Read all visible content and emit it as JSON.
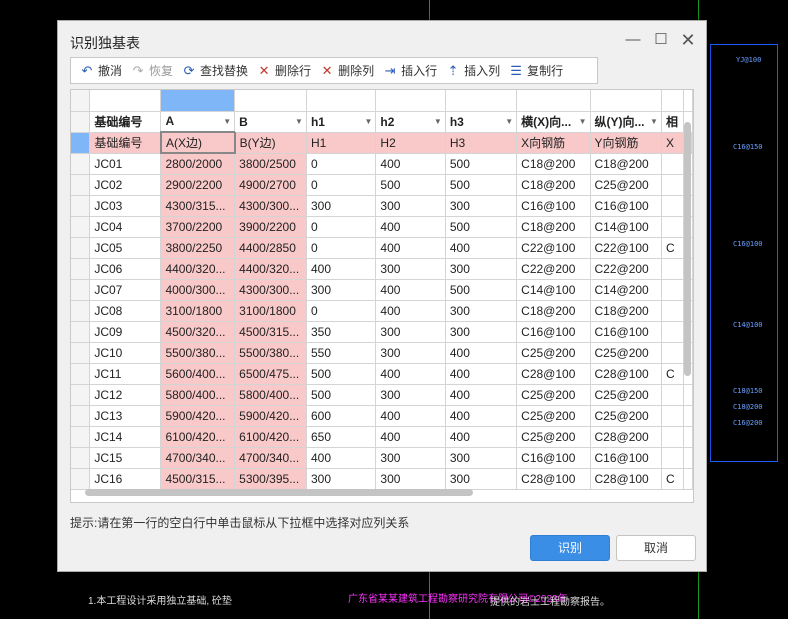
{
  "dialog": {
    "title": "识别独基表",
    "hint": "提示:请在第一行的空白行中单击鼠标从下拉框中选择对应列关系",
    "ok_label": "识别",
    "cancel_label": "取消"
  },
  "toolbar": [
    {
      "label": "撤消",
      "icon": "undo-icon",
      "glyph": "↶",
      "enabled": true
    },
    {
      "label": "恢复",
      "icon": "redo-icon",
      "glyph": "↷",
      "enabled": false
    },
    {
      "label": "查找替换",
      "icon": "find-replace-icon",
      "glyph": "⟳",
      "enabled": true
    },
    {
      "label": "删除行",
      "icon": "delete-row-icon",
      "glyph": "✕",
      "enabled": true
    },
    {
      "label": "删除列",
      "icon": "delete-column-icon",
      "glyph": "✕",
      "enabled": true
    },
    {
      "label": "插入行",
      "icon": "insert-row-icon",
      "glyph": "⇥",
      "enabled": true
    },
    {
      "label": "插入列",
      "icon": "insert-column-icon",
      "glyph": "⇡",
      "enabled": true
    },
    {
      "label": "复制行",
      "icon": "copy-row-icon",
      "glyph": "☰",
      "enabled": true
    }
  ],
  "grid": {
    "headers": [
      "基础编号",
      "A",
      "B",
      "h1",
      "h2",
      "h3",
      "横(X)向...",
      "纵(Y)向...",
      "相"
    ],
    "mapping": [
      "基础编号",
      "A(X边)",
      "B(Y边)",
      "H1",
      "H2",
      "H3",
      "X向钢筋",
      "Y向钢筋",
      "X"
    ],
    "rows": [
      [
        "JC01",
        "2800/2000",
        "3800/2500",
        "0",
        "400",
        "500",
        "C18@200",
        "C18@200",
        ""
      ],
      [
        "JC02",
        "2900/2200",
        "4900/2700",
        "0",
        "500",
        "500",
        "C18@200",
        "C25@200",
        ""
      ],
      [
        "JC03",
        "4300/315...",
        "4300/300...",
        "300",
        "300",
        "300",
        "C16@100",
        "C16@100",
        ""
      ],
      [
        "JC04",
        "3700/2200",
        "3900/2200",
        "0",
        "400",
        "500",
        "C18@200",
        "C14@100",
        ""
      ],
      [
        "JC05",
        "3800/2250",
        "4400/2850",
        "0",
        "400",
        "400",
        "C22@100",
        "C22@100",
        "C"
      ],
      [
        "JC06",
        "4400/320...",
        "4400/320...",
        "400",
        "300",
        "300",
        "C22@200",
        "C22@200",
        ""
      ],
      [
        "JC07",
        "4000/300...",
        "4300/300...",
        "300",
        "400",
        "500",
        "C14@100",
        "C14@200",
        ""
      ],
      [
        "JC08",
        "3100/1800",
        "3100/1800",
        "0",
        "400",
        "300",
        "C18@200",
        "C18@200",
        ""
      ],
      [
        "JC09",
        "4500/320...",
        "4500/315...",
        "350",
        "300",
        "300",
        "C16@100",
        "C16@100",
        ""
      ],
      [
        "JC10",
        "5500/380...",
        "5500/380...",
        "550",
        "300",
        "400",
        "C25@200",
        "C25@200",
        ""
      ],
      [
        "JC11",
        "5600/400...",
        "6500/475...",
        "500",
        "400",
        "400",
        "C28@100",
        "C28@100",
        "C"
      ],
      [
        "JC12",
        "5800/400...",
        "5800/400...",
        "500",
        "300",
        "400",
        "C25@200",
        "C25@200",
        ""
      ],
      [
        "JC13",
        "5900/420...",
        "5900/420...",
        "600",
        "400",
        "400",
        "C25@200",
        "C25@200",
        ""
      ],
      [
        "JC14",
        "6100/420...",
        "6100/420...",
        "650",
        "400",
        "400",
        "C25@200",
        "C28@200",
        ""
      ],
      [
        "JC15",
        "4700/340...",
        "4700/340...",
        "400",
        "300",
        "300",
        "C16@100",
        "C16@100",
        ""
      ],
      [
        "JC16",
        "4500/315...",
        "5300/395...",
        "300",
        "300",
        "300",
        "C28@100",
        "C28@100",
        "C"
      ]
    ]
  },
  "cad": {
    "labels": [
      "YJ@100",
      "C16@150",
      "C16@100",
      "C14@100",
      "C18@150",
      "C18@200",
      "C16@200"
    ],
    "bottom_text": "1.本工程设计采用独立基础, 砼垫",
    "magenta_text": "广东省某某建筑工程勘察研究院有限公司©2023年",
    "bottom_text2": "提供的岩土工程勘察报告。"
  },
  "colors": {
    "accent": "#3a8ee6",
    "selected_col": "#7eb6f7",
    "mapped_cell": "#f9c9c9"
  }
}
